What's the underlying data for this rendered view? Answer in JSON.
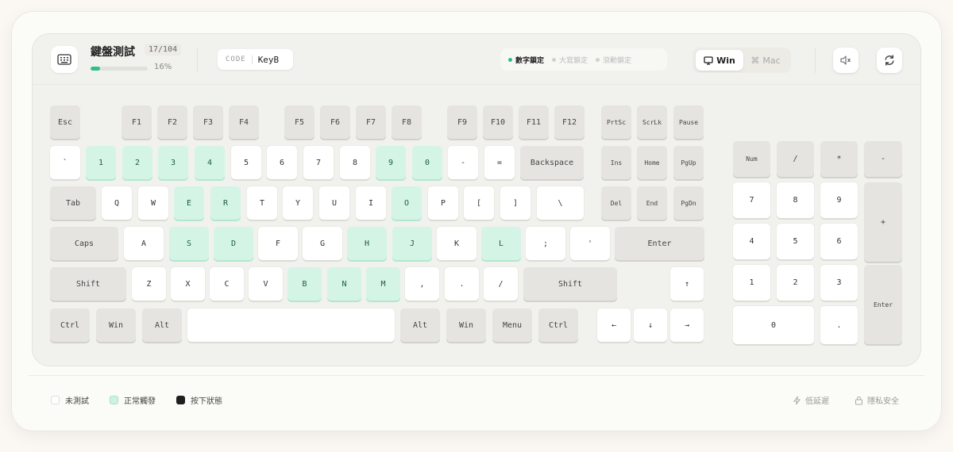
{
  "header": {
    "title": "鍵盤測試",
    "count": "17/104",
    "progress_percent": 16,
    "progress_label": "16%",
    "code_label": "CODE",
    "code_value": "KeyB",
    "locks": [
      {
        "label": "數字鎖定",
        "active": true
      },
      {
        "label": "大寫鎖定",
        "active": false
      },
      {
        "label": "滾動鎖定",
        "active": false
      }
    ],
    "os_options": [
      {
        "label": "Win",
        "icon": "monitor-icon",
        "active": true
      },
      {
        "label": "Mac",
        "icon": "command-icon",
        "active": false
      }
    ]
  },
  "keys": {
    "esc": "Esc",
    "f1": "F1",
    "f2": "F2",
    "f3": "F3",
    "f4": "F4",
    "f5": "F5",
    "f6": "F6",
    "f7": "F7",
    "f8": "F8",
    "f9": "F9",
    "f10": "F10",
    "f11": "F11",
    "f12": "F12",
    "prtsc": "PrtSc",
    "scrlk": "ScrLk",
    "pause": "Pause",
    "backtick": "`",
    "d1": "1",
    "d2": "2",
    "d3": "3",
    "d4": "4",
    "d5": "5",
    "d6": "6",
    "d7": "7",
    "d8": "8",
    "d9": "9",
    "d0": "0",
    "minus": "-",
    "equal": "=",
    "backspace": "Backspace",
    "ins": "Ins",
    "home": "Home",
    "pgup": "PgUp",
    "tab": "Tab",
    "q": "Q",
    "w": "W",
    "e": "E",
    "r": "R",
    "t": "T",
    "y": "Y",
    "u": "U",
    "i": "I",
    "o": "O",
    "p": "P",
    "lbracket": "[",
    "rbracket": "]",
    "backslash": "\\",
    "del": "Del",
    "end": "End",
    "pgdn": "PgDn",
    "caps": "Caps",
    "a": "A",
    "s": "S",
    "d": "D",
    "f": "F",
    "g": "G",
    "h": "H",
    "j": "J",
    "k": "K",
    "l": "L",
    "semicolon": ";",
    "quote": "'",
    "enter": "Enter",
    "lshift": "Shift",
    "z": "Z",
    "x": "X",
    "c": "C",
    "v": "V",
    "b": "B",
    "n": "N",
    "m": "M",
    "comma": ",",
    "period": ".",
    "slash": "/",
    "rshift": "Shift",
    "lctrl": "Ctrl",
    "lwin": "Win",
    "lalt": "Alt",
    "space": "",
    "ralt": "Alt",
    "rwin": "Win",
    "menu": "Menu",
    "rctrl": "Ctrl",
    "up": "↑",
    "left": "←",
    "down": "↓",
    "right": "→",
    "num": "Num",
    "np_div": "/",
    "np_mul": "*",
    "np_sub": "-",
    "np7": "7",
    "np8": "8",
    "np9": "9",
    "np_add": "+",
    "np4": "4",
    "np5": "5",
    "np6": "6",
    "np1": "1",
    "np2": "2",
    "np3": "3",
    "np_enter": "Enter",
    "np0": "0",
    "np_dot": "."
  },
  "tested_keys": [
    "d1",
    "d2",
    "d3",
    "d4",
    "d9",
    "d0",
    "e",
    "r",
    "o",
    "s",
    "d",
    "h",
    "j",
    "l",
    "b",
    "n",
    "m"
  ],
  "legend": [
    {
      "label": "未測試",
      "swatch": "untested"
    },
    {
      "label": "正常觸發",
      "swatch": "triggered"
    },
    {
      "label": "按下狀態",
      "swatch": "pressed"
    }
  ],
  "footer": {
    "latency_label": "低延遲",
    "privacy_label": "隱私安全"
  },
  "colors": {
    "accent": "#2fbf8a",
    "tested_key": "#d4f5e6",
    "modifier_key": "#e6e4e0"
  }
}
